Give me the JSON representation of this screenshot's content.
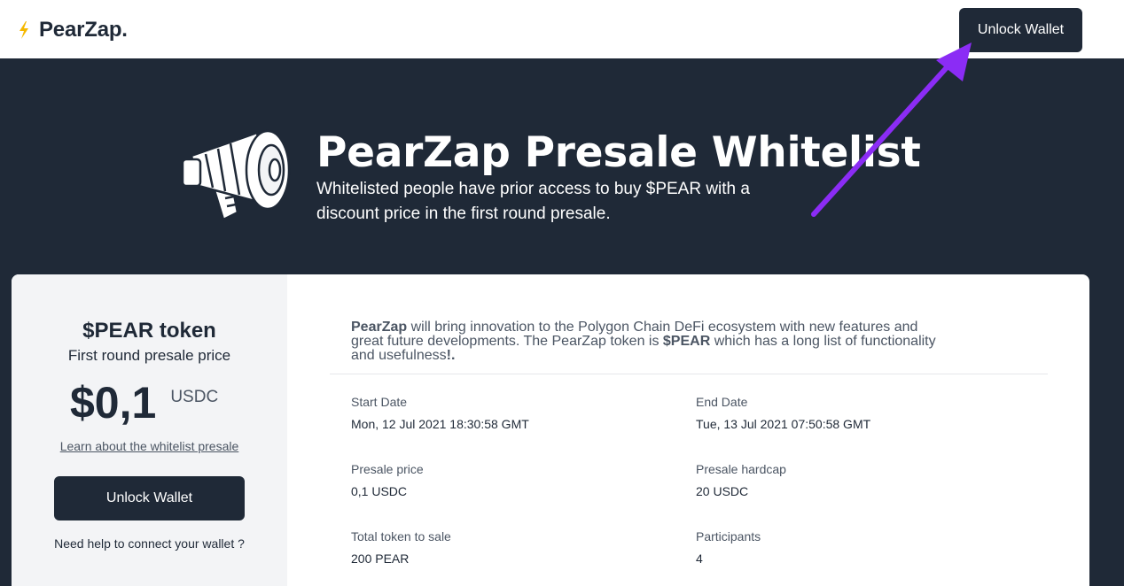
{
  "header": {
    "brand": "PearZap.",
    "logo_icon": "lightning-icon",
    "unlock_label": "Unlock Wallet"
  },
  "hero": {
    "icon": "megaphone-icon",
    "title": "PearZap Presale Whitelist",
    "subtitle": "Whitelisted people have prior access to buy $PEAR with a discount price in the first round presale."
  },
  "sidebar": {
    "token_title": "$PEAR token",
    "token_subtitle": "First round presale price",
    "price": "$0,1",
    "unit": "USDC",
    "learn_link": "Learn about the whitelist presale",
    "unlock_label": "Unlock Wallet",
    "help_text": "Need help to connect your wallet ?"
  },
  "description": {
    "brand": "PearZap",
    "part1": " will bring innovation to the Polygon Chain DeFi ecosystem with new features and great future developments. The PearZap token is ",
    "token": "$PEAR",
    "part2": " which has a long list of functionality and usefulness",
    "ending": "!."
  },
  "stats": [
    {
      "label": "Start Date",
      "value": "Mon, 12 Jul 2021 18:30:58 GMT"
    },
    {
      "label": "End Date",
      "value": "Tue, 13 Jul 2021 07:50:58 GMT"
    },
    {
      "label": "Presale price",
      "value": "0,1 USDC"
    },
    {
      "label": "Presale hardcap",
      "value": "20 USDC"
    },
    {
      "label": "Total token to sale",
      "value": "200 PEAR"
    },
    {
      "label": "Participants",
      "value": "4"
    }
  ],
  "colors": {
    "dark": "#1f2937",
    "accent_lightning": "#f5b800",
    "annotation_arrow": "#8b2cf5"
  }
}
